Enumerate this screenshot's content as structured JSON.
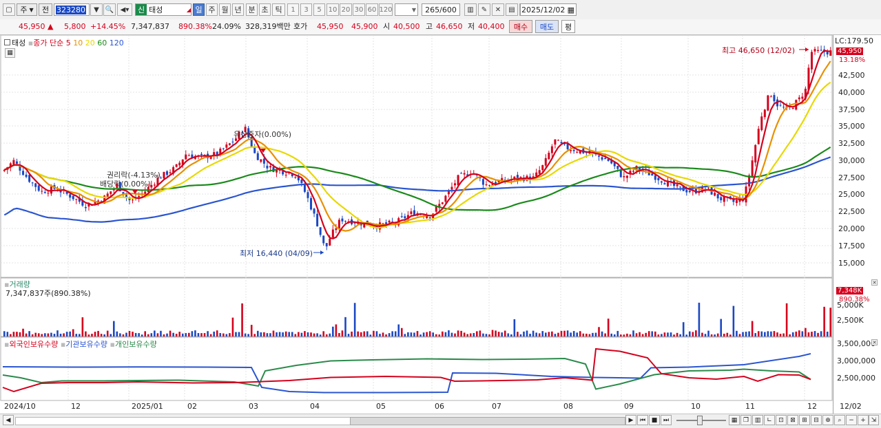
{
  "toolbar": {
    "market": "주",
    "prev": "전",
    "code": "323280",
    "new_badge": "신",
    "stock_name": "태성",
    "periods": [
      "일",
      "주",
      "월",
      "년",
      "분",
      "초",
      "틱"
    ],
    "nums": [
      "1",
      "3",
      "5",
      "10",
      "20",
      "30",
      "60",
      "120"
    ],
    "count": "265",
    "total": "/600",
    "date": "2025/12/02"
  },
  "quote": {
    "price": "45,950",
    "up_arrow": "▲",
    "change": "5,800",
    "rate": "+14.45%",
    "volume": "7,347,837",
    "vol_rate": "890.38%",
    "turnover": "24.09%",
    "amount": "328,319백만",
    "bid_label": "호가",
    "ask": "45,950",
    "bid": "45,900",
    "open_label": "시",
    "open": "40,500",
    "high_label": "고",
    "high": "46,650",
    "low_label": "저",
    "low": "40,400",
    "buy_btn": "매수",
    "sell_btn": "매도",
    "eval_btn": "평"
  },
  "price_pane": {
    "legend_name": "태성",
    "legend_ma": "종가 단순",
    "ma_periods": [
      "5",
      "10",
      "20",
      "60",
      "120"
    ],
    "ma_colors": [
      "#d4001c",
      "#e89000",
      "#e8d800",
      "#1a8a1a",
      "#2a55d0"
    ],
    "ticks": [
      "42,500",
      "40,000",
      "37,500",
      "35,000",
      "32,500",
      "30,000",
      "27,500",
      "25,000",
      "22,500",
      "20,000",
      "17,500",
      "15,000"
    ],
    "lc": "LC:179.50",
    "last_price_tag": "45,950",
    "pct_tag": "13.18%",
    "high_note": "최고 46,650 (12/02)",
    "low_note": "최저 16,440 (04/09)",
    "note1": "권리락(-4.13%)",
    "note2": "배당락(0.00%)",
    "note3": "유상증자(0.00%)"
  },
  "volume_pane": {
    "title": "거래량",
    "value": "7,347,837주(890.38%)",
    "tag": "7,348K",
    "tag2": "890.38%",
    "ticks": [
      "5,000K",
      "2,500K"
    ]
  },
  "holding_pane": {
    "legend": [
      "외국인보유수량",
      "기관보유수량",
      "개인보유수량"
    ],
    "colors": [
      "#d4001c",
      "#2a55d0",
      "#2a8a4a"
    ],
    "ticks": [
      "3,500,000",
      "3,000,000",
      "2,500,000"
    ]
  },
  "x_axis": [
    "2024/10",
    "12",
    "2025/01",
    "02",
    "03",
    "04",
    "05",
    "06",
    "07",
    "08",
    "09",
    "10",
    "11",
    "12",
    "12/02"
  ]
}
